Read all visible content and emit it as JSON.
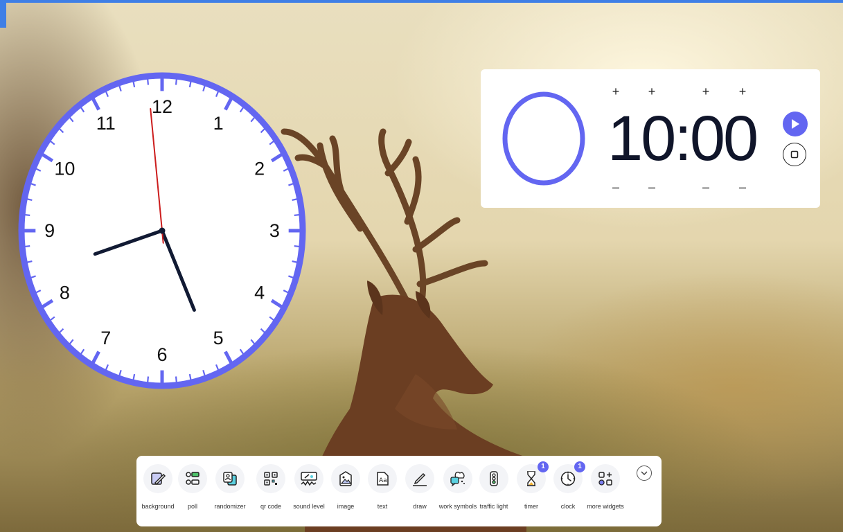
{
  "timer": {
    "display": "10:00",
    "increment_symbol": "+",
    "decrement_symbol": "–",
    "ring_color": "#6366f1",
    "play_icon": "play-icon",
    "stop_icon": "stop-icon"
  },
  "clock": {
    "numbers": [
      "12",
      "1",
      "2",
      "3",
      "4",
      "5",
      "6",
      "7",
      "8",
      "9",
      "10",
      "11"
    ],
    "time": {
      "hour": 8,
      "minute": 25,
      "second": 59
    },
    "rim_color": "#6366f1",
    "second_hand_color": "#cc1d1d"
  },
  "toolbar": {
    "items": [
      {
        "label": "background",
        "icon": "background-icon"
      },
      {
        "label": "poll",
        "icon": "poll-icon"
      },
      {
        "label": "randomizer",
        "icon": "randomizer-icon"
      },
      {
        "label": "qr code",
        "icon": "qr-code-icon"
      },
      {
        "label": "sound level",
        "icon": "sound-level-icon"
      },
      {
        "label": "image",
        "icon": "image-icon"
      },
      {
        "label": "text",
        "icon": "text-icon"
      },
      {
        "label": "draw",
        "icon": "draw-icon"
      },
      {
        "label": "work symbols",
        "icon": "work-symbols-icon"
      },
      {
        "label": "traffic light",
        "icon": "traffic-light-icon"
      },
      {
        "label": "timer",
        "icon": "hourglass-icon",
        "badge": "1"
      },
      {
        "label": "clock",
        "icon": "clock-icon",
        "badge": "1"
      },
      {
        "label": "more widgets",
        "icon": "more-widgets-icon"
      }
    ],
    "collapse_icon": "chevron-down-icon"
  },
  "colors": {
    "accent": "#6366f1",
    "top_bar": "#3f7fe6"
  }
}
